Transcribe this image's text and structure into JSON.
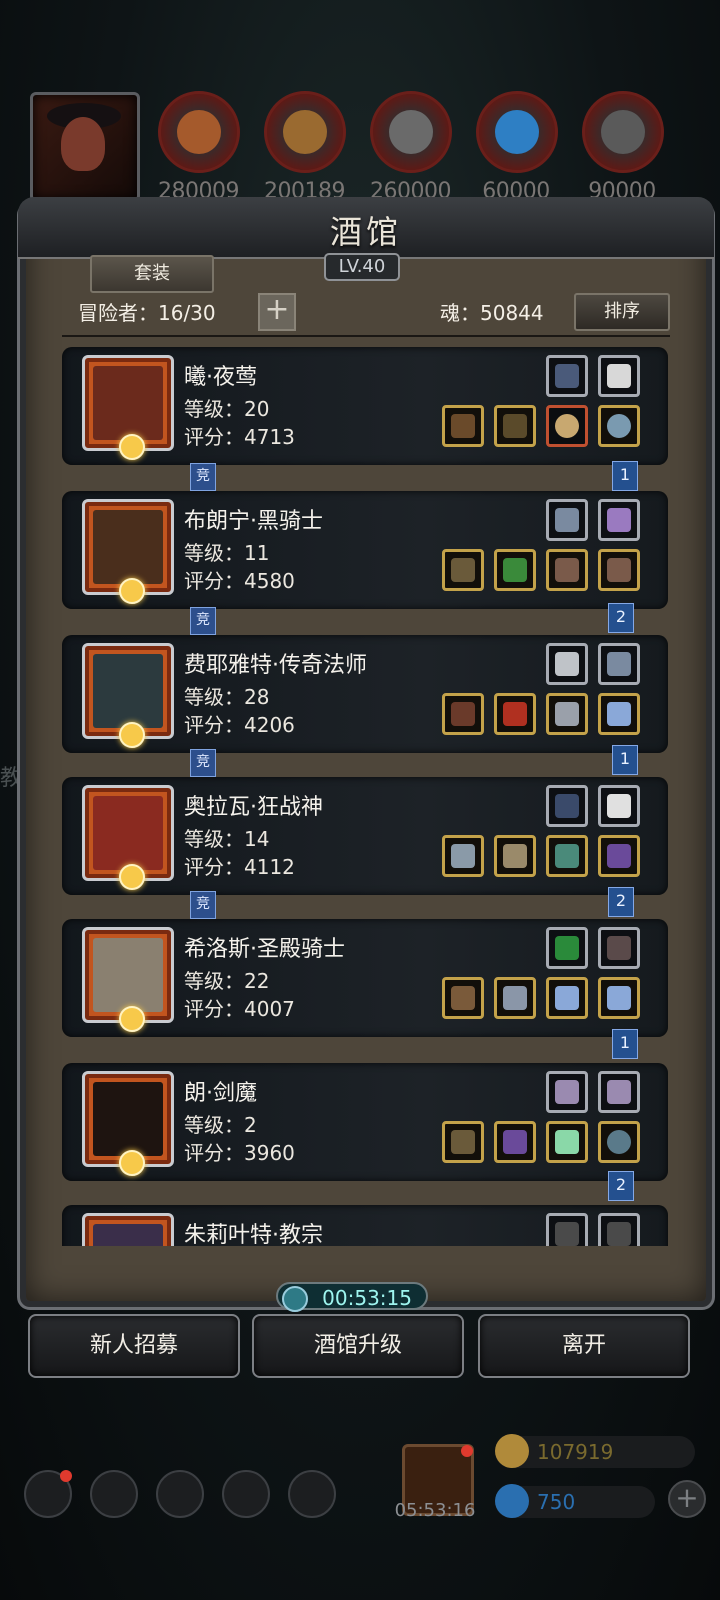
{
  "resources": [
    {
      "icon": "ore-icon",
      "amount": "280009",
      "color": "#a55a2c"
    },
    {
      "icon": "wood-icon",
      "amount": "200189",
      "color": "#9a6a30"
    },
    {
      "icon": "stone-icon",
      "amount": "260000",
      "color": "#6a6a6a"
    },
    {
      "icon": "crystal-icon",
      "amount": "60000",
      "color": "#2e7fc4"
    },
    {
      "icon": "iron-icon",
      "amount": "90000",
      "color": "#5a5a5a"
    }
  ],
  "panel": {
    "title": "酒馆",
    "level": "LV.40",
    "set_button": "套装",
    "adventurers_label": "冒险者：16/30",
    "plus_label": "+",
    "soul_label": "魂：50844",
    "sort_button": "排序"
  },
  "heroes": [
    {
      "name": "曦·夜莺",
      "level": "等级：20",
      "score": "评分：4713",
      "tag": "竞",
      "num": "1",
      "portrait_color": "#6b2a1c"
    },
    {
      "name": "布朗宁·黑骑士",
      "level": "等级：11",
      "score": "评分：4580",
      "tag": "竞",
      "num": "2",
      "portrait_color": "#4a2e1c"
    },
    {
      "name": "费耶雅特·传奇法师",
      "level": "等级：28",
      "score": "评分：4206",
      "tag": "竞",
      "num": "1",
      "portrait_color": "#2c3a3e"
    },
    {
      "name": "奥拉瓦·狂战神",
      "level": "等级：14",
      "score": "评分：4112",
      "tag": "竞",
      "num": "2",
      "portrait_color": "#8a2a20"
    },
    {
      "name": "希洛斯·圣殿骑士",
      "level": "等级：22",
      "score": "评分：4007",
      "tag": "",
      "num": "1",
      "portrait_color": "#8a8070"
    },
    {
      "name": "朗·剑魔",
      "level": "等级：2",
      "score": "评分：3960",
      "tag": "",
      "num": "2",
      "portrait_color": "#1e1410"
    },
    {
      "name": "朱莉叶特·教宗",
      "level": "",
      "score": "",
      "tag": "",
      "num": "",
      "portrait_color": "#3a2e4a"
    }
  ],
  "timer": "00:53:15",
  "buttons": {
    "recruit": "新人招募",
    "upgrade": "酒馆升级",
    "leave": "离开"
  },
  "bottom": {
    "gift_timer": "05:53:16",
    "gold": "107919",
    "gems": "750",
    "plus": "+"
  },
  "side_text": "教"
}
